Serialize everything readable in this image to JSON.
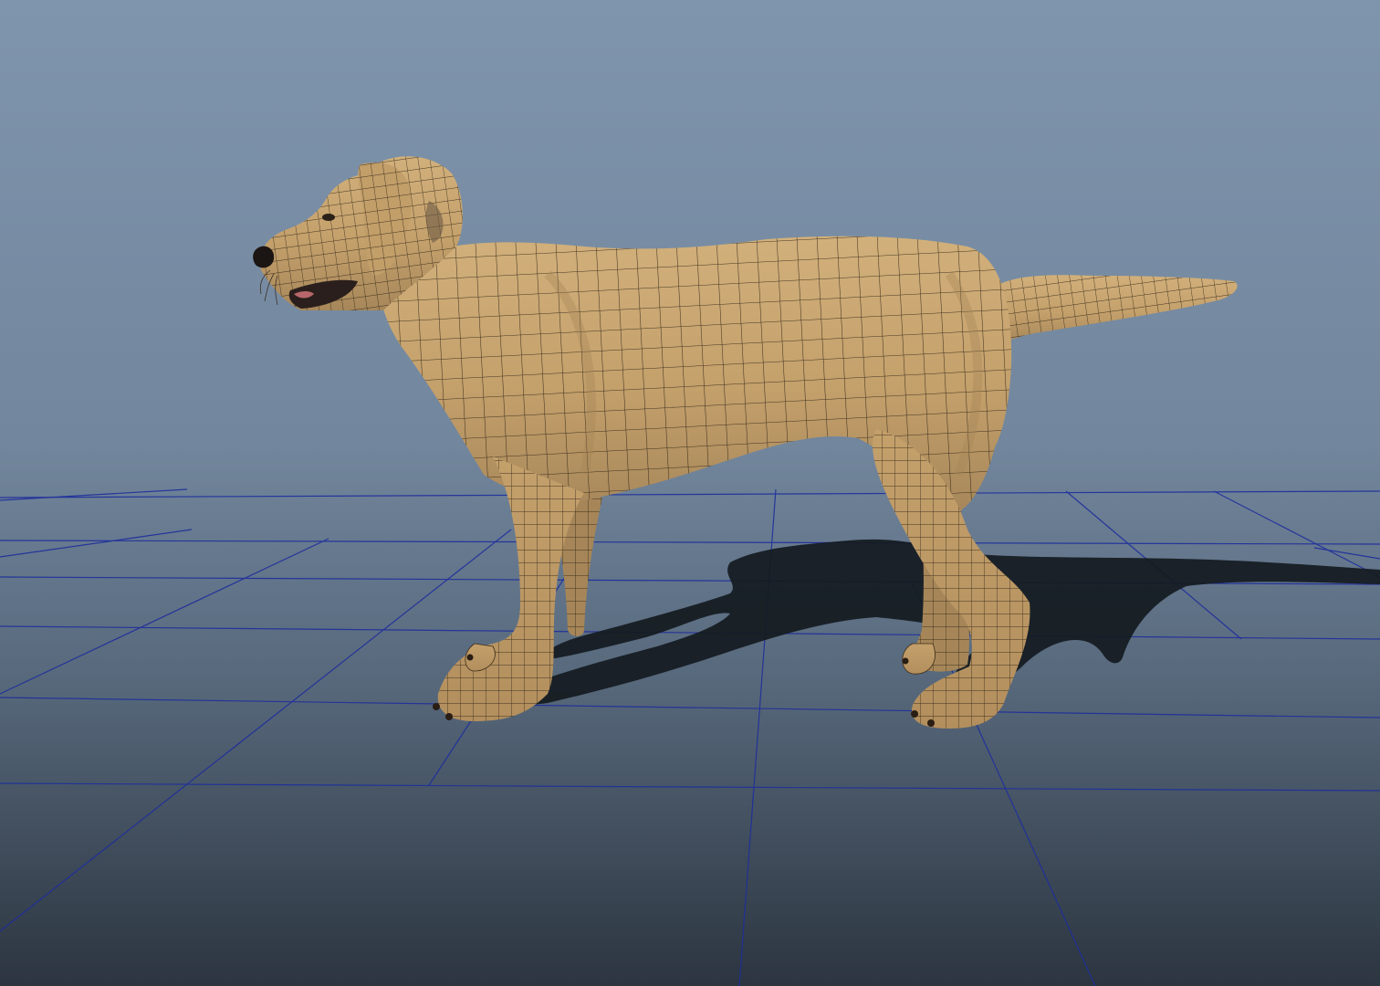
{
  "viewport": {
    "panel": "3D viewport",
    "display_mode": "shaded-wireframe-on-shaded",
    "grid_visible": true,
    "shadows_visible": true,
    "subject": "dog-model",
    "colors": {
      "background_top": "#7d93ac",
      "background_bottom": "#2f3843",
      "grid_line": "#1c2c9a",
      "fur": "#c9a774",
      "fur_shade": "#9e7f52",
      "wire": "#2a2114",
      "shadow": "#151a20",
      "nose": "#1b1613"
    }
  }
}
